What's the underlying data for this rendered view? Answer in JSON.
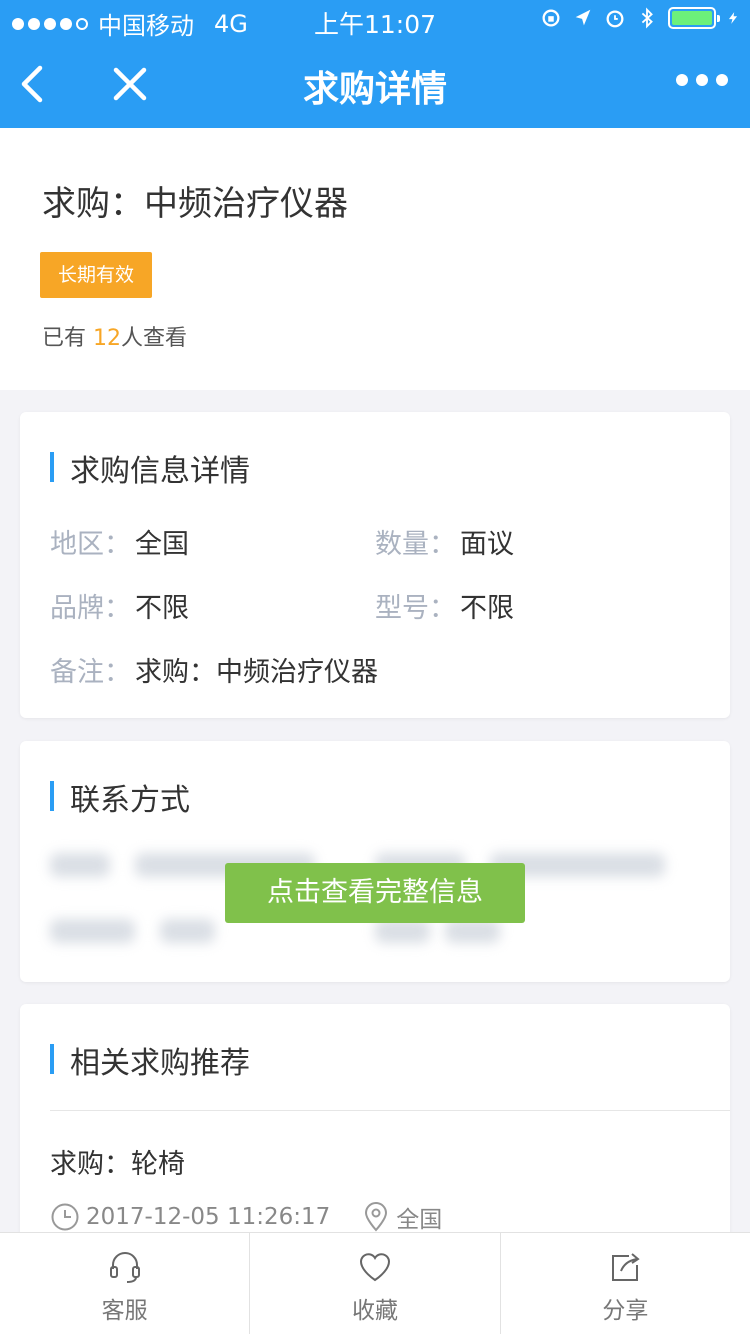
{
  "status_bar": {
    "carrier": "中国移动",
    "network": "4G",
    "time": "上午11:07"
  },
  "nav": {
    "title": "求购详情"
  },
  "header": {
    "title": "求购：中频治疗仪器",
    "badge": "长期有效",
    "views_prefix": "已有 ",
    "views_count": "12",
    "views_suffix": "人查看"
  },
  "info_card": {
    "title": "求购信息详情",
    "region_label": "地区：",
    "region_value": "全国",
    "quantity_label": "数量：",
    "quantity_value": "面议",
    "brand_label": "品牌：",
    "brand_value": "不限",
    "model_label": "型号：",
    "model_value": "不限",
    "note_label": "备注：",
    "note_value": "求购：中频治疗仪器"
  },
  "contact_card": {
    "title": "联系方式",
    "view_button": "点击查看完整信息"
  },
  "related_card": {
    "title": "相关求购推荐",
    "item_title": "求购：轮椅",
    "item_time": "2017-12-05 11:26:17",
    "item_region": "全国"
  },
  "tabbar": {
    "service": "客服",
    "favorite": "收藏",
    "share": "分享"
  },
  "colors": {
    "primary": "#2a9df4",
    "badge": "#f7a626",
    "cta": "#80c14b"
  }
}
